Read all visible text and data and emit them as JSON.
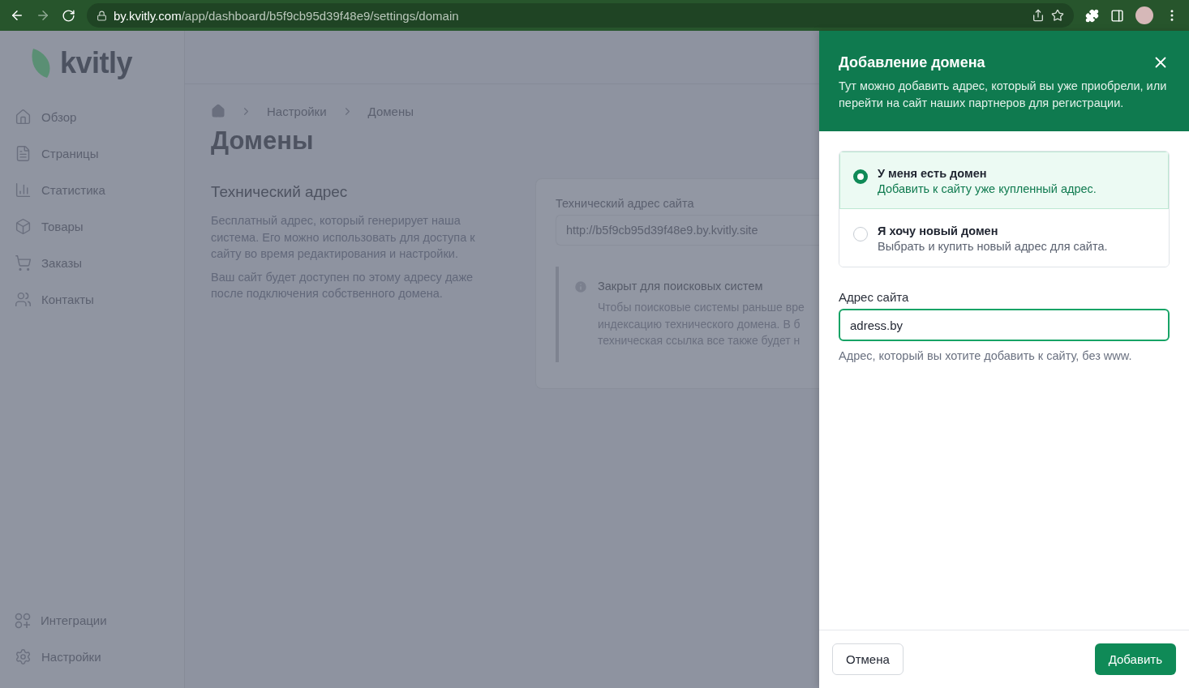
{
  "browser": {
    "url_host": "by.kvitly.com",
    "url_path": "/app/dashboard/b5f9cb95d39f48e9/settings/domain"
  },
  "sidebar": {
    "logo": "kvitly",
    "items": [
      {
        "label": "Обзор"
      },
      {
        "label": "Страницы"
      },
      {
        "label": "Статистика"
      },
      {
        "label": "Товары"
      },
      {
        "label": "Заказы"
      },
      {
        "label": "Контакты"
      }
    ],
    "bottom_items": [
      {
        "label": "Интеграции"
      },
      {
        "label": "Настройки"
      }
    ]
  },
  "breadcrumb": [
    "Настройки",
    "Домены"
  ],
  "page_title": "Домены",
  "section": {
    "title": "Технический адрес",
    "paragraphs": [
      "Бесплатный адрес, который генерирует наша система. Его можно использовать для доступа к сайту во время редактирования и настройки.",
      "Ваш сайт будет доступен по этому адресу даже после подключения собственного домена."
    ]
  },
  "card": {
    "field_label": "Технический адрес сайта",
    "field_value": "http://b5f9cb95d39f48e9.by.kvitly.site",
    "notice": {
      "title": "Закрыт для поисковых систем",
      "lines": [
        "Чтобы поисковые системы раньше вре",
        "индексацию технического домена. В б",
        "техническая ссылка все также будет н"
      ]
    }
  },
  "drawer": {
    "title": "Добавление домена",
    "description": "Тут можно добавить адрес, который вы уже приобрели, или перейти на сайт наших партнеров для регистрации.",
    "options": [
      {
        "title": "У меня есть домен",
        "subtitle": "Добавить к сайту уже купленный адрес.",
        "selected": true
      },
      {
        "title": "Я хочу новый домен",
        "subtitle": "Выбрать и купить новый адрес для сайта.",
        "selected": false
      }
    ],
    "field_label": "Адрес сайта",
    "field_value": "adress.by",
    "hint": "Адрес, который вы хотите добавить к сайту, без www.",
    "cancel": "Отмена",
    "submit": "Добавить"
  }
}
